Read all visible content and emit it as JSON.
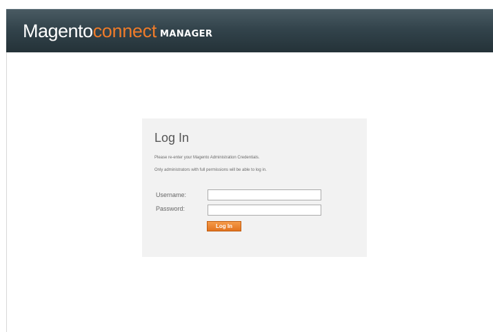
{
  "header": {
    "logo_magento": "Magento",
    "logo_connect": "connect",
    "logo_manager": "MANAGER"
  },
  "login": {
    "title": "Log In",
    "instruction_1": "Please re-enter your Magento Administration Credentials.",
    "instruction_2": "Only administrators with full permissions will be able to log in.",
    "username_label": "Username:",
    "username_value": "",
    "password_label": "Password:",
    "password_value": "",
    "button_label": "Log In"
  },
  "colors": {
    "header_dark": "#33444c",
    "brand_orange": "#ee7b2a",
    "box_background": "#f2f2f2"
  }
}
